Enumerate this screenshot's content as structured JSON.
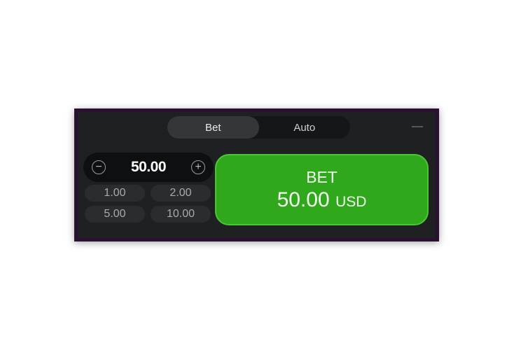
{
  "tabs": [
    {
      "label": "Bet",
      "active": true
    },
    {
      "label": "Auto",
      "active": false
    }
  ],
  "stepper": {
    "minus_symbol": "−",
    "value": "50.00",
    "plus_symbol": "+"
  },
  "quick_amounts": [
    "1.00",
    "2.00",
    "5.00",
    "10.00"
  ],
  "bet_button": {
    "title": "BET",
    "amount": "50.00",
    "currency": "USD"
  },
  "colors": {
    "frame": "#2a1033",
    "panel": "#1f2022",
    "bet_green": "#2fa81c"
  },
  "icons": [
    "minus-circle-icon",
    "plus-circle-icon",
    "collapse-icon"
  ]
}
